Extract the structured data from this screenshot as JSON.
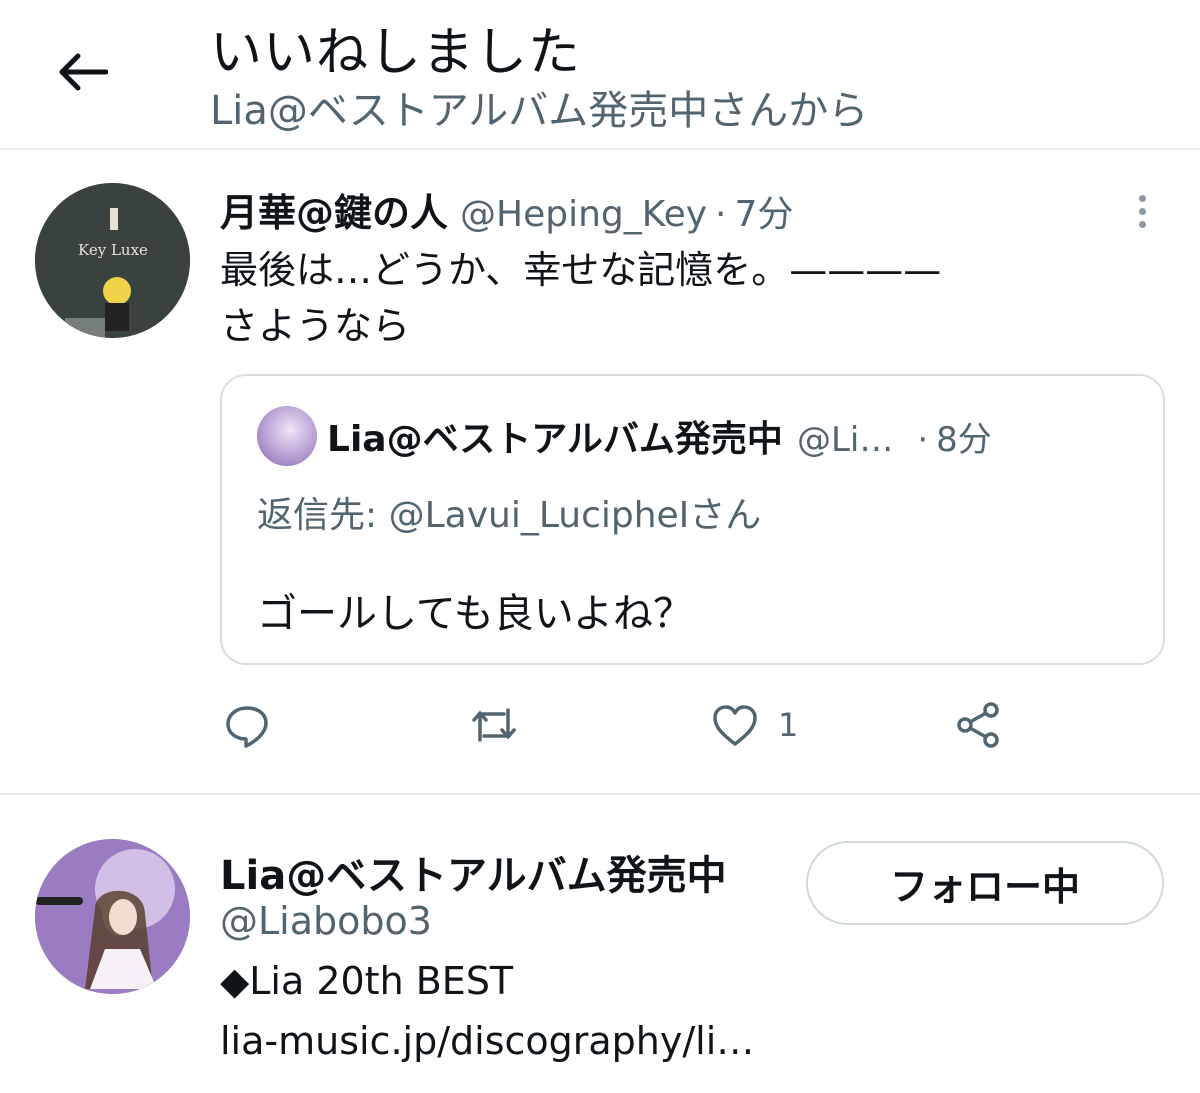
{
  "header": {
    "title": "いいねしました",
    "subtitle": "Lia@ベストアルバム発売中さんから",
    "back_icon": "arrow-left-icon"
  },
  "tweet": {
    "author_name": "月華@鍵の人",
    "author_handle": "@Heping_Key",
    "separator": "·",
    "time": "7分",
    "text_line1": "最後は…どうか、幸せな記憶を。————",
    "text_line2": "さようなら",
    "quote": {
      "author_name": "Lia@ベストアルバム発売中",
      "author_handle": "@Li…",
      "separator": "·",
      "time": "8分",
      "reply_label": "返信先:",
      "reply_to": "@Lavui_LucipheIさん",
      "text": "ゴールしても良いよね？"
    },
    "actions": {
      "like_count": "1"
    },
    "avatar_text": "Key Luxe"
  },
  "user_card": {
    "name": "Lia@ベストアルバム発売中",
    "handle": "@Liabobo3",
    "bio_line1": "◆Lia 20th BEST",
    "bio_line2": "lia-music.jp/discography/li…",
    "follow_label": "フォロー中"
  },
  "colors": {
    "text": "#0f1419",
    "secondary": "#536471",
    "border": "#e6ecf0"
  }
}
